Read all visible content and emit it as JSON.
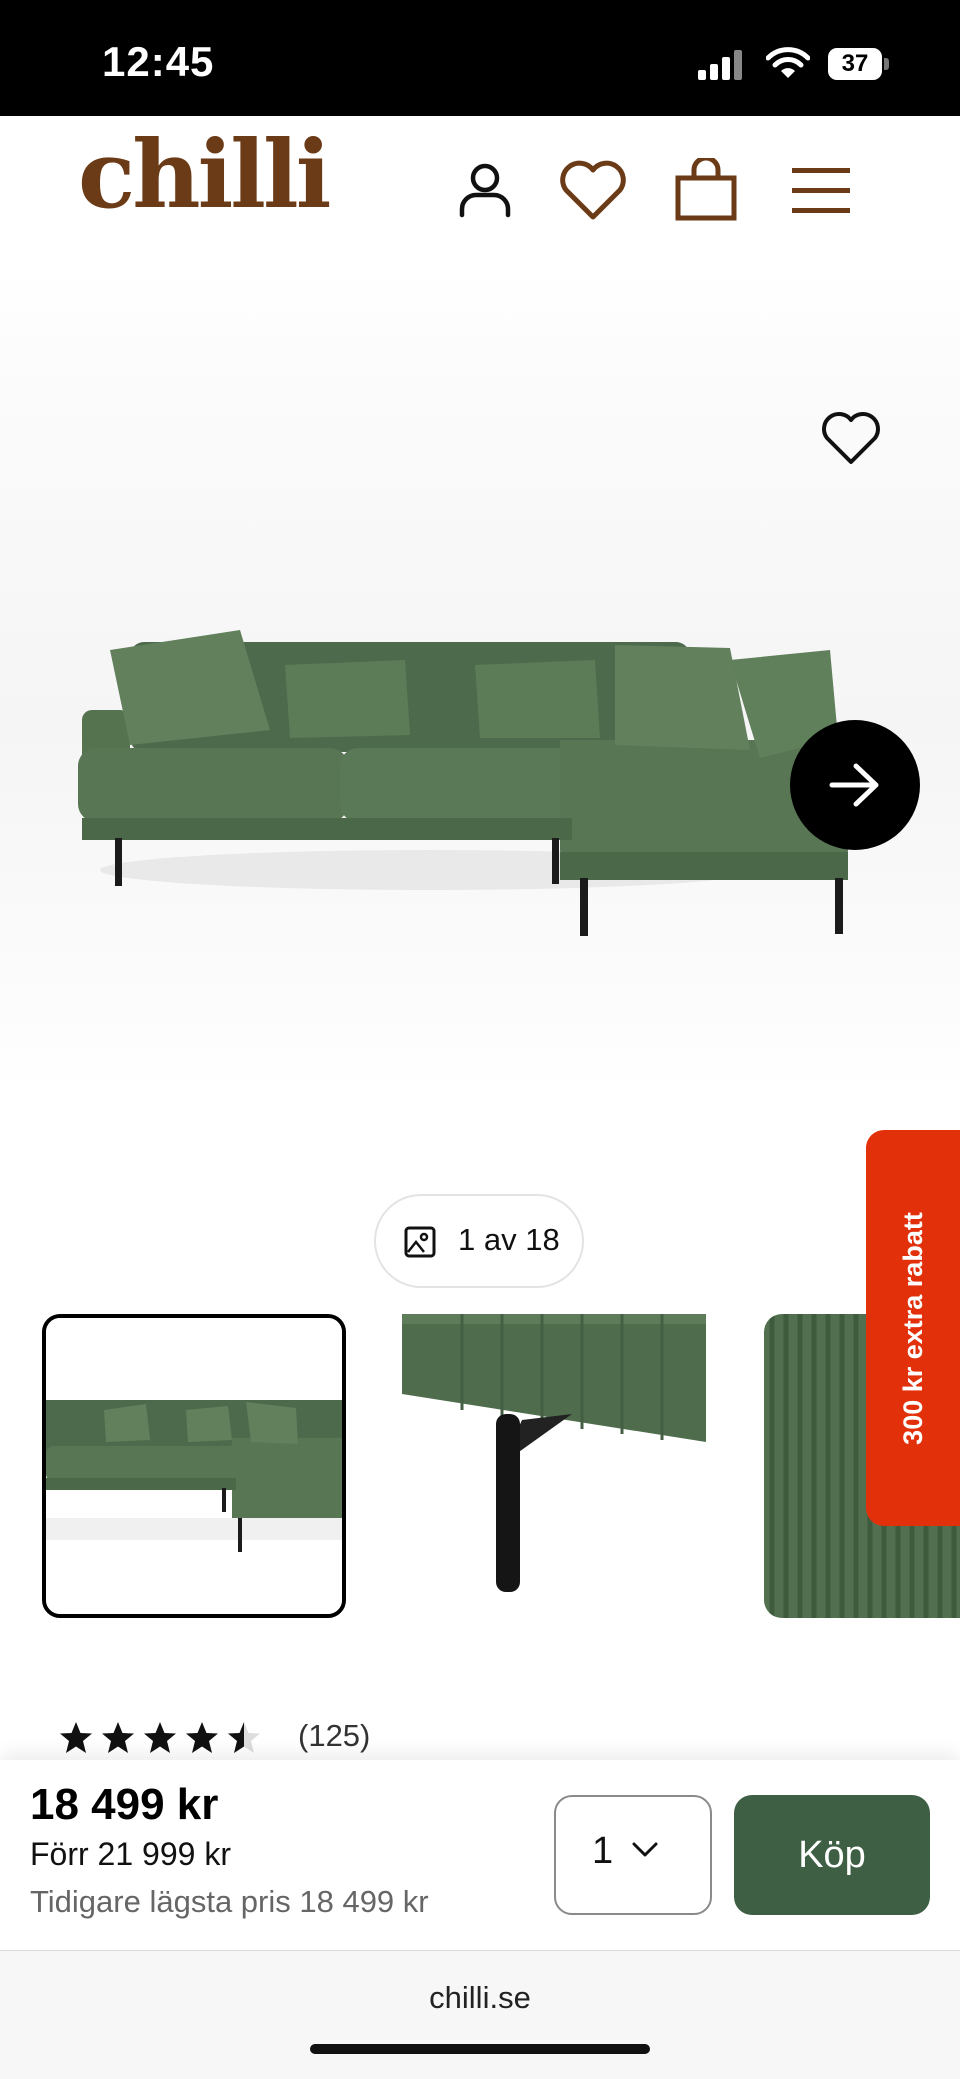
{
  "status_bar": {
    "time": "12:45",
    "battery": "37"
  },
  "header": {
    "logo": "chilli",
    "icons": [
      "user-icon",
      "heart-icon",
      "bag-icon",
      "menu-icon"
    ],
    "brand_color": "#6b3a16"
  },
  "gallery": {
    "counter": "1 av 18",
    "current_image": 1,
    "total_images": 18,
    "thumbnails": [
      "sofa-overview",
      "leg-detail",
      "fabric-detail"
    ]
  },
  "promo": {
    "label": "300 kr extra rabatt",
    "color": "#e2300b"
  },
  "rating": {
    "stars": 4.5,
    "max": 5,
    "count": "(125)"
  },
  "buy_bar": {
    "price": "18 499 kr",
    "before_price": "Förr 21 999 kr",
    "lowest_price": "Tidigare lägsta pris 18 499 kr",
    "quantity": "1",
    "buy_label": "Köp",
    "button_color": "#3f5f45"
  },
  "browser": {
    "url": "chilli.se"
  }
}
